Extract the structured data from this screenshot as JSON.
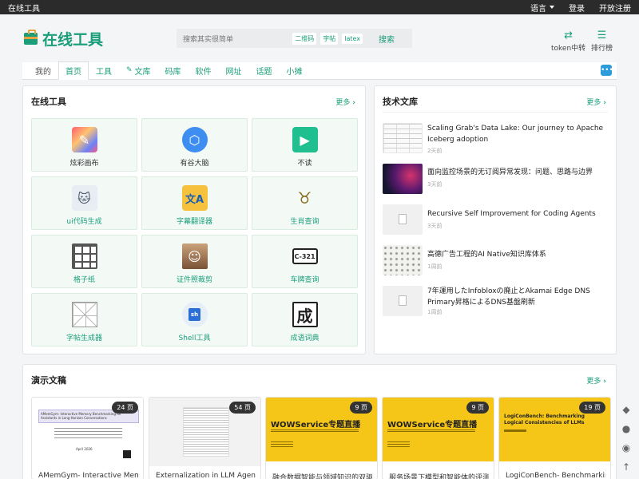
{
  "topbar": {
    "site_name": "在线工具",
    "language": "语言",
    "login": "登录",
    "register": "开放注册"
  },
  "header": {
    "logo_text": "在线工具",
    "search_placeholder": "搜索其实很简单",
    "search_chips": [
      "二维码",
      "字帖",
      "latex"
    ],
    "search_button": "搜索",
    "token_label": "token中转",
    "rank_label": "排行榜"
  },
  "nav": {
    "items": [
      "我的",
      "首页",
      "工具",
      "文库",
      "码库",
      "软件",
      "网址",
      "话题",
      "小摊"
    ]
  },
  "tools_panel": {
    "title": "在线工具",
    "more": "更多",
    "items": [
      {
        "label": "炫彩画布",
        "icon": "paint-brush-icon"
      },
      {
        "label": "有谷大脑",
        "icon": "hexagon-icon"
      },
      {
        "label": "不读",
        "icon": "book-icon"
      },
      {
        "label": "ui代码生成",
        "icon": "github-cat-icon"
      },
      {
        "label": "字幕翻译器",
        "icon": "translate-icon"
      },
      {
        "label": "生肖查询",
        "icon": "ox-icon"
      },
      {
        "label": "格子纸",
        "icon": "grid-icon"
      },
      {
        "label": "证件照裁剪",
        "icon": "portrait-icon"
      },
      {
        "label": "车牌查询",
        "icon": "license-plate-icon"
      },
      {
        "label": "字帖生成器",
        "icon": "calligraphy-grid-icon"
      },
      {
        "label": "Shell工具",
        "icon": "shell-file-icon"
      },
      {
        "label": "成语词典",
        "icon": "idiom-icon"
      }
    ],
    "plate_text": "C-321",
    "shell_badge": "sh",
    "idiom_char": "成"
  },
  "articles_panel": {
    "title": "技术文库",
    "more": "更多",
    "items": [
      {
        "title": "Scaling Grab's Data Lake: Our journey to Apache Iceberg adoption",
        "time": "2天前"
      },
      {
        "title": "面向监控场景的无订阅异常发现：问题、思路与边界",
        "time": "3天前"
      },
      {
        "title": "Recursive Self Improvement for Coding Agents",
        "time": "3天前"
      },
      {
        "title": "高德广告工程的AI Native知识库体系",
        "time": "1周前"
      },
      {
        "title": "7年運用したInfobloxの廃止とAkamai Edge DNS Primary昇格によるDNS基盤刷新",
        "time": "1周前"
      }
    ]
  },
  "slides_panel": {
    "title": "演示文稿",
    "more": "更多",
    "items": [
      {
        "pages": "24 页",
        "title": "AMemGym- Interactive Memory",
        "cover_title": "AMemGym: Interactive Memory Benchmarking for Assistants in Long-Horizon Conversations",
        "cover_date": "April 2026"
      },
      {
        "pages": "54 页",
        "title": "Externalization in LLM Agents- A"
      },
      {
        "pages": "9 页",
        "title": "融合数据智能与领域知识的双驱动",
        "cover_title": "WOWService专题直播"
      },
      {
        "pages": "9 页",
        "title": "服务场景下模型和智能体的评测体",
        "cover_title": "WOWService专题直播"
      },
      {
        "pages": "19 页",
        "title": "LogiConBench- Benchmarking",
        "cover_title": "LogiConBench: Benchmarking Logical Consistencies of LLMs"
      }
    ]
  },
  "colors": {
    "accent": "#1a9e7a",
    "topbar": "#2b2b2b",
    "wow_yellow": "#f5c518"
  }
}
